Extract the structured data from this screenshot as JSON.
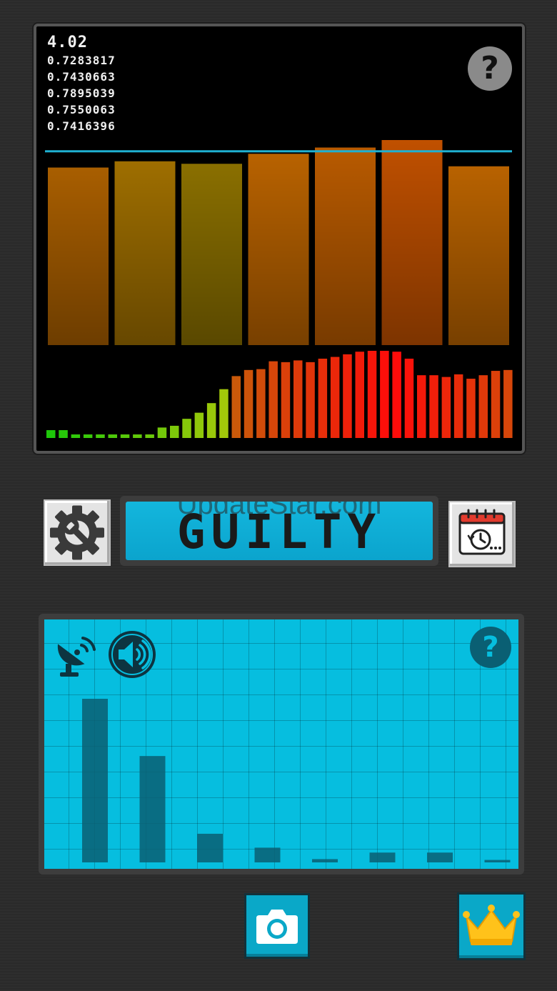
{
  "monitor": {
    "readout_main": "4.02",
    "readouts": [
      "0.7283817",
      "0.7430663",
      "0.7895039",
      "0.7550063",
      "0.7416396"
    ],
    "help_label": "?"
  },
  "verdict": {
    "label": "GUILTY",
    "watermark": "UpdateStar.com"
  },
  "spectrum": {
    "help_label": "?"
  },
  "colors": {
    "threshold_line": "#1fb0d2",
    "panel_cyan": "#06bedf",
    "verdict_cyan": "#13b6dd",
    "button_teal": "#0aa8c8",
    "dark_bar": "#0a5f73"
  },
  "icons": {
    "settings": "wrench-gear-icon",
    "history": "calendar-clock-icon",
    "monitor_help": "question-icon",
    "spectrum_help": "question-icon",
    "satellite": "satellite-dish-icon",
    "sound": "speaker-icon",
    "camera": "camera-icon",
    "premium": "crown-icon"
  },
  "chart_data": [
    {
      "type": "bar",
      "name_of_chart": "",
      "scale": "relative 0-1",
      "threshold": 0.775,
      "values": [
        0.71,
        0.735,
        0.725,
        0.765,
        0.79,
        0.82,
        0.715
      ],
      "colors": [
        "#a85e00",
        "#9e6e00",
        "#8a6f00",
        "#b86200",
        "#b85a00",
        "#c05000",
        "#b86200"
      ]
    },
    {
      "type": "bar",
      "scale": "relative 0-1",
      "values": [
        0.09,
        0.09,
        0.04,
        0.04,
        0.04,
        0.04,
        0.04,
        0.04,
        0.04,
        0.12,
        0.14,
        0.22,
        0.29,
        0.4,
        0.56,
        0.71,
        0.78,
        0.79,
        0.88,
        0.87,
        0.89,
        0.87,
        0.91,
        0.93,
        0.96,
        0.99,
        1.0,
        1.0,
        0.99,
        0.91,
        0.72,
        0.72,
        0.7,
        0.73,
        0.68,
        0.72,
        0.77,
        0.78
      ]
    },
    {
      "type": "bar",
      "scale": "relative 0-1",
      "values": [
        1.0,
        0.65,
        0.175,
        0.09,
        0.02,
        0.06,
        0.06,
        0.015
      ]
    }
  ]
}
